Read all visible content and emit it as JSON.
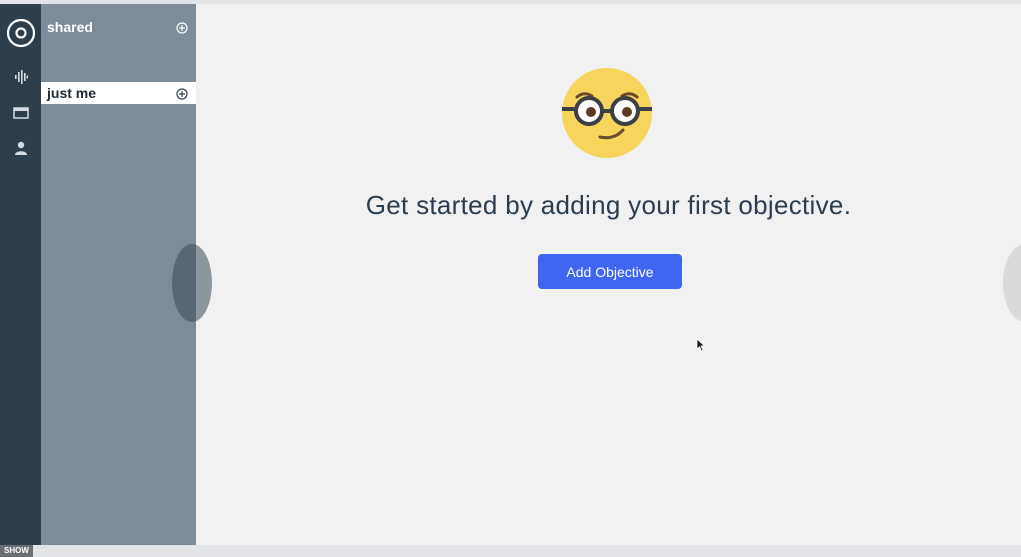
{
  "sidebar": {
    "sections": [
      {
        "label": "shared"
      },
      {
        "label": "just me"
      }
    ]
  },
  "rail": {
    "icons": [
      "logo-ring-icon",
      "activity-icon",
      "window-icon",
      "person-icon"
    ]
  },
  "main": {
    "headline": "Get started by adding your first objective.",
    "cta_label": "Add Objective"
  },
  "footer": {
    "show_label": "SHOW"
  },
  "colors": {
    "rail": "#2e3e4b",
    "panel": "#7e8b98",
    "accent": "#3f66f0",
    "background": "#f1f1f2"
  }
}
